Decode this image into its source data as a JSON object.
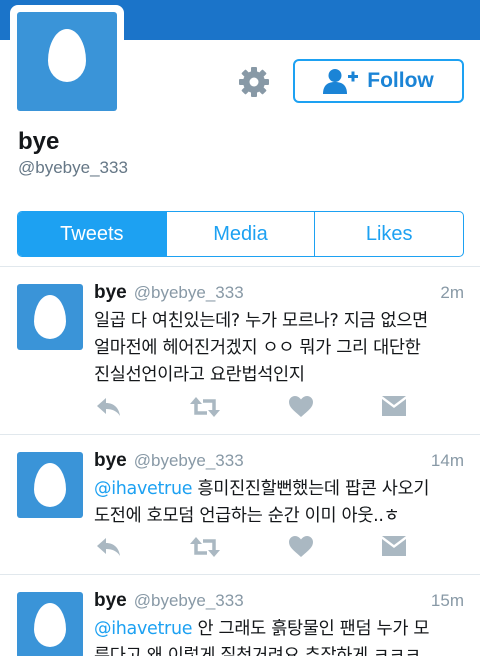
{
  "profile": {
    "name": "bye",
    "handle": "@byebye_333",
    "follow_label": "Follow"
  },
  "tabs": [
    {
      "label": "Tweets",
      "active": true
    },
    {
      "label": "Media",
      "active": false
    },
    {
      "label": "Likes",
      "active": false
    }
  ],
  "tweets": [
    {
      "name": "bye",
      "handle": "@byebye_333",
      "time": "2m",
      "mention": "",
      "lines": [
        "일곱 다 여친있는데? 누가 모르나? 지금 없으면",
        "얼마전에 헤어진거겠지 ㅇㅇ 뭐가 그리 대단한",
        "진실선언이라고 요란법석인지"
      ]
    },
    {
      "name": "bye",
      "handle": "@byebye_333",
      "time": "14m",
      "mention": "@ihavetrue",
      "lines": [
        " 흥미진진할뻔했는데 팝콘 사오기",
        "도전에 호모덤 언급하는 순간 이미 아웃..ㅎ"
      ]
    },
    {
      "name": "bye",
      "handle": "@byebye_333",
      "time": "15m",
      "mention": "@ihavetrue",
      "lines": [
        " 안 그래도 흙탕물인 팬덤 누가 모",
        "른다고 왜 이렇게 질척거려요 추잡하게 ㅋㅋㅋ"
      ]
    }
  ],
  "icons": {
    "gear": "gear-icon",
    "follow": "add-user-icon",
    "reply": "reply-icon",
    "retweet": "retweet-icon",
    "like": "heart-icon",
    "dm": "envelope-icon"
  },
  "colors": {
    "banner": "#1b74c9",
    "accent": "#1da1f2",
    "avatar": "#3a94d8",
    "muted": "#8899a6",
    "icon": "#aab8c2"
  }
}
